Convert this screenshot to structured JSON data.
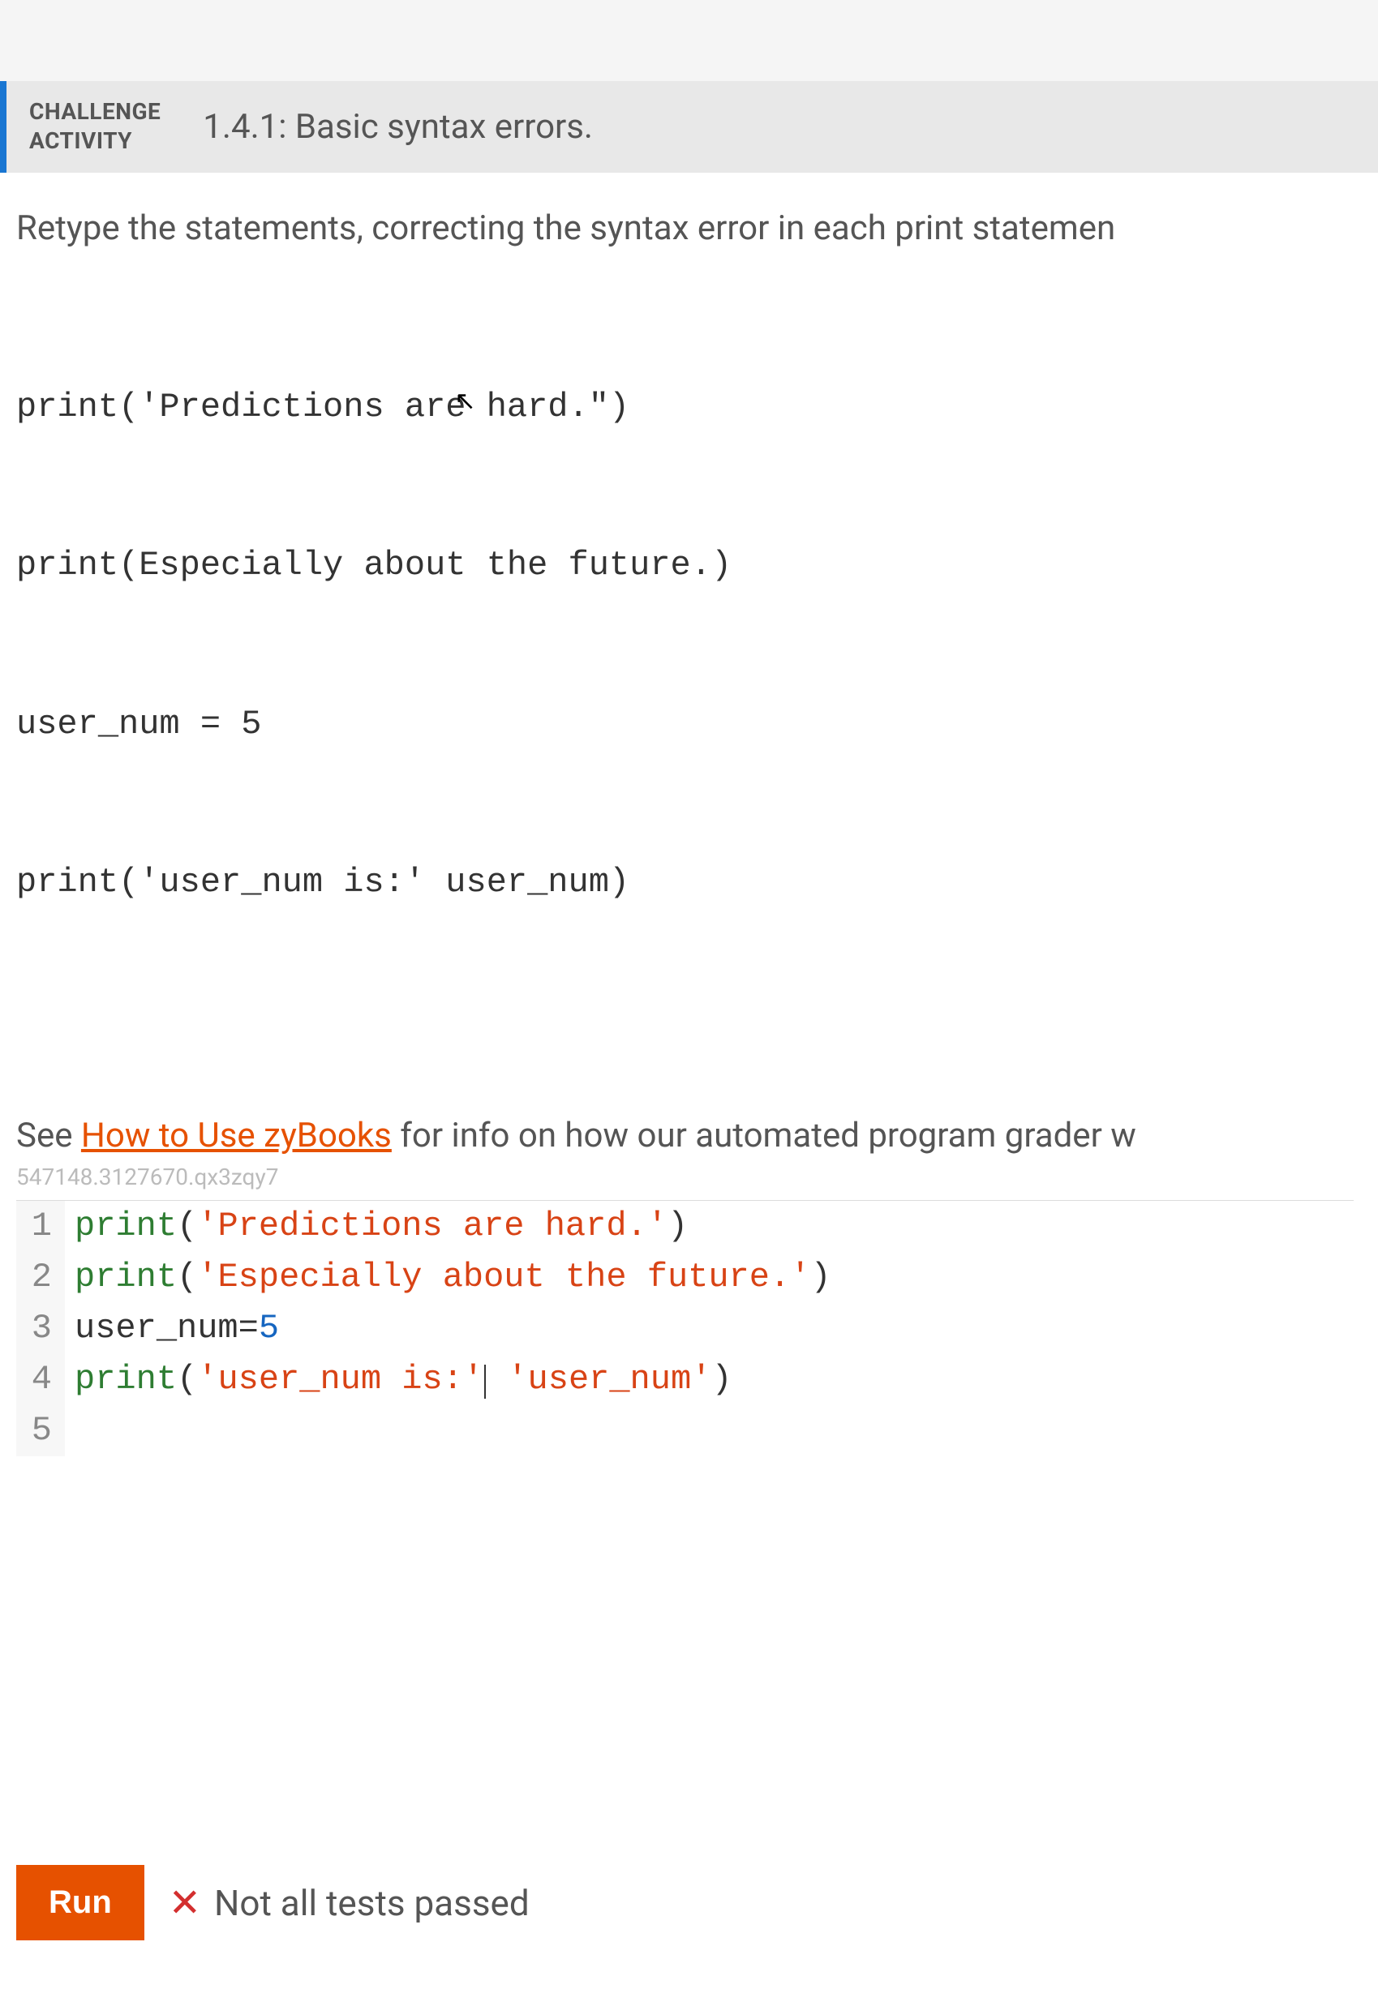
{
  "header": {
    "challenge_label_line1": "CHALLENGE",
    "challenge_label_line2": "ACTIVITY",
    "title": "1.4.1: Basic syntax errors."
  },
  "instructions": "Retype the statements, correcting the syntax error in each print statemen",
  "problem_code": {
    "line1": "print('Predictions are hard.\")",
    "line2": "print(Especially about the future.)",
    "line3": "user_num = 5",
    "line4": "print('user_num is:' user_num)"
  },
  "see_text_prefix": "See ",
  "see_link_text": "How to Use zyBooks",
  "see_text_suffix": " for info on how our automated program grader w",
  "watermark": "547148.3127670.qx3zqy7",
  "editor": {
    "lines": [
      {
        "n": "1",
        "tokens": [
          {
            "t": "print",
            "c": "tok-fn"
          },
          {
            "t": "(",
            "c": "tok-op"
          },
          {
            "t": "'Predictions are hard.'",
            "c": "tok-str"
          },
          {
            "t": ")",
            "c": "tok-op"
          }
        ]
      },
      {
        "n": "2",
        "tokens": [
          {
            "t": "print",
            "c": "tok-fn"
          },
          {
            "t": "(",
            "c": "tok-op"
          },
          {
            "t": "'Especially about the future.'",
            "c": "tok-str"
          },
          {
            "t": ")",
            "c": "tok-op"
          }
        ]
      },
      {
        "n": "3",
        "tokens": [
          {
            "t": "user_num",
            "c": ""
          },
          {
            "t": "=",
            "c": "tok-op"
          },
          {
            "t": "5",
            "c": "tok-num"
          }
        ]
      },
      {
        "n": "4",
        "tokens": [
          {
            "t": "print",
            "c": "tok-fn"
          },
          {
            "t": "(",
            "c": "tok-op"
          },
          {
            "t": "'user_num is:'",
            "c": "tok-str"
          },
          {
            "t": "CURSOR",
            "c": "cursor-marker"
          },
          {
            "t": " ",
            "c": ""
          },
          {
            "t": "'user_num'",
            "c": "tok-str"
          },
          {
            "t": ")",
            "c": "tok-op"
          }
        ]
      },
      {
        "n": "5",
        "tokens": []
      }
    ]
  },
  "run_button": "Run",
  "result_status": "Not all tests passed"
}
